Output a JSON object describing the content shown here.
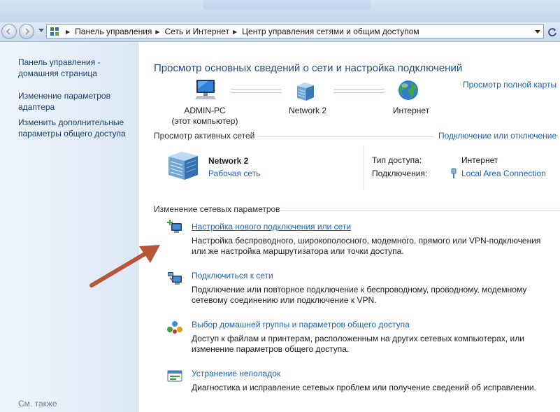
{
  "breadcrumb": {
    "items": [
      "Панель управления",
      "Сеть и Интернет",
      "Центр управления сетями и общим доступом"
    ]
  },
  "sidebar": {
    "items": [
      {
        "label": "Панель управления - домашняя страница"
      },
      {
        "label": "Изменение параметров адаптера"
      },
      {
        "label": "Изменить дополнительные параметры общего доступа"
      }
    ],
    "see_also": "См. также"
  },
  "main": {
    "title": "Просмотр основных сведений о сети и настройка подключений",
    "full_map_link": "Просмотр полной карты",
    "map": {
      "computer_name": "ADMIN-PC",
      "computer_sub": "(этот компьютер)",
      "network_name": "Network  2",
      "internet_label": "Интернет"
    },
    "active_networks": {
      "header": "Просмотр активных сетей",
      "connect_link": "Подключение или отключение",
      "network_name": "Network  2",
      "network_type": "Рабочая сеть",
      "access_type_label": "Тип доступа:",
      "access_type_value": "Интернет",
      "connections_label": "Подключения:",
      "connections_value": "Local Area Connection"
    },
    "change_settings": {
      "header": "Изменение сетевых параметров",
      "tasks": [
        {
          "title": "Настройка нового подключения или сети",
          "desc": "Настройка беспроводного, широкополосного, модемного, прямого или VPN-подключения или же настройка маршрутизатора или точки доступа.",
          "icon": "new-connection-icon"
        },
        {
          "title": "Подключиться к сети",
          "desc": "Подключение или повторное подключение к беспроводному, проводному, модемному сетевому соединению или подключение к VPN.",
          "icon": "connect-network-icon"
        },
        {
          "title": "Выбор домашней группы и параметров общего доступа",
          "desc": "Доступ к файлам и принтерам, расположенным на других сетевых компьютерах, или изменение параметров общего доступа.",
          "icon": "homegroup-icon"
        },
        {
          "title": "Устранение неполадок",
          "desc": "Диагностика и исправление сетевых проблем или получение сведений об исправлении.",
          "icon": "troubleshoot-icon"
        }
      ]
    }
  },
  "colors": {
    "link": "#1a62c4",
    "title": "#1f4f8c",
    "annotation_arrow": "#b8563a"
  }
}
